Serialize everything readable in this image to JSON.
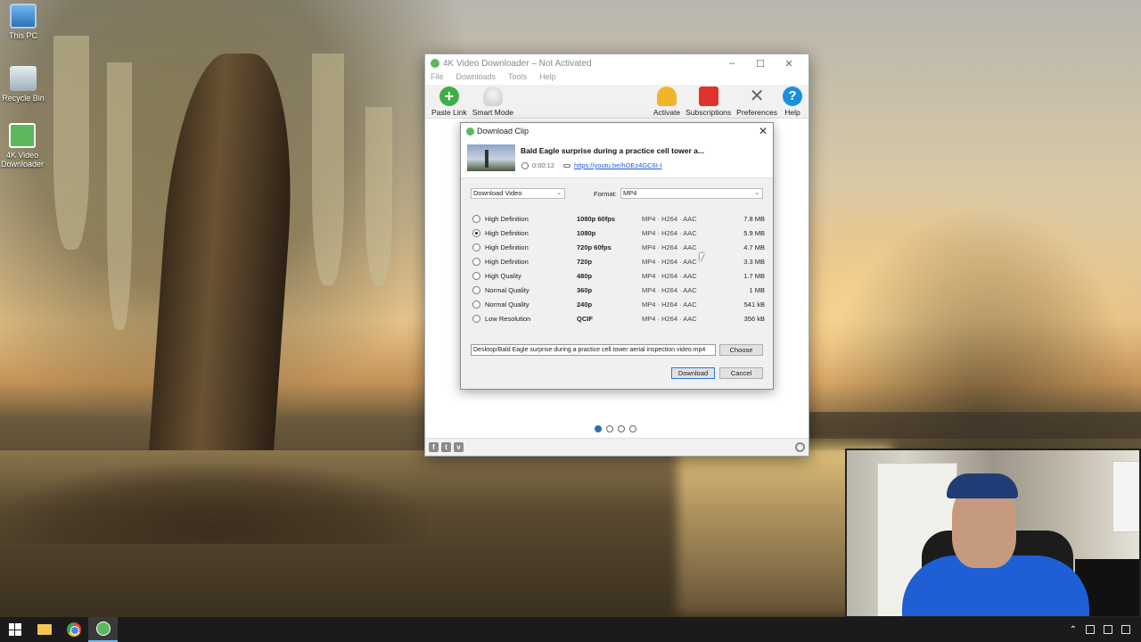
{
  "desktop": {
    "icons": [
      {
        "label": "This PC",
        "icon": "computer-icon"
      },
      {
        "label": "Recycle Bin",
        "icon": "recycle-bin-icon"
      },
      {
        "label": "4K Video Downloader",
        "icon": "4k-video-downloader-icon"
      }
    ]
  },
  "app": {
    "title": "4K Video Downloader – Not Activated",
    "window_controls": {
      "minimize": "–",
      "maximize": "☐",
      "close": "✕"
    },
    "menu": [
      "File",
      "Downloads",
      "Tools",
      "Help"
    ],
    "toolbar": {
      "paste_link": "Paste Link",
      "smart_mode": "Smart Mode",
      "activate": "Activate",
      "subscriptions": "Subscriptions",
      "preferences": "Preferences",
      "help": "Help"
    },
    "pager": {
      "pages": 4,
      "active": 1
    },
    "status_social": [
      "f",
      "t",
      "v"
    ]
  },
  "dialog": {
    "title": "Download Clip",
    "clip": {
      "title": "Bald Eagle surprise during a practice cell tower a...",
      "duration": "0:00:12",
      "url": "https://youtu.be/hOEz4GC6I-I"
    },
    "download_type": "Download Video",
    "format_label": "Format:",
    "format_value": "MP4",
    "qualities": [
      {
        "name": "High Definition",
        "resolution": "1080p 60fps",
        "codec": "MP4 · H264 · AAC",
        "size": "7.8 MB",
        "selected": false
      },
      {
        "name": "High Definition",
        "resolution": "1080p",
        "codec": "MP4 · H264 · AAC",
        "size": "5.9 MB",
        "selected": true
      },
      {
        "name": "High Definition",
        "resolution": "720p 60fps",
        "codec": "MP4 · H264 · AAC",
        "size": "4.7 MB",
        "selected": false
      },
      {
        "name": "High Definition",
        "resolution": "720p",
        "codec": "MP4 · H264 · AAC",
        "size": "3.3 MB",
        "selected": false
      },
      {
        "name": "High Quality",
        "resolution": "480p",
        "codec": "MP4 · H264 · AAC",
        "size": "1.7 MB",
        "selected": false
      },
      {
        "name": "Normal Quality",
        "resolution": "360p",
        "codec": "MP4 · H264 · AAC",
        "size": "1 MB",
        "selected": false
      },
      {
        "name": "Normal Quality",
        "resolution": "240p",
        "codec": "MP4 · H264 · AAC",
        "size": "541 kB",
        "selected": false
      },
      {
        "name": "Low Resolution",
        "resolution": "QCIF",
        "codec": "MP4 · H264 · AAC",
        "size": "356 kB",
        "selected": false
      }
    ],
    "save_path": "Desktop/Bald Eagle surprise during a practice cell tower aerial inspection video.mp4",
    "choose_label": "Choose",
    "download_label": "Download",
    "cancel_label": "Cancel"
  },
  "taskbar": {
    "apps": [
      "start-icon",
      "file-explorer-icon",
      "chrome-icon",
      "4k-video-downloader-icon"
    ]
  },
  "colors": {
    "accent": "#2b78d4",
    "app_green": "#5cb85c",
    "link": "#1a5bd8"
  }
}
